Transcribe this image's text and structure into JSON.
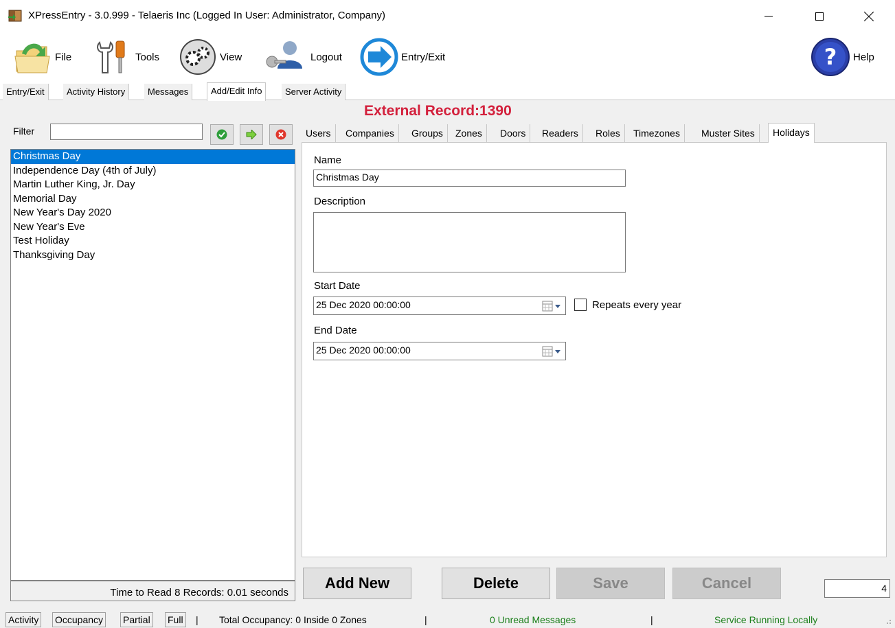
{
  "window": {
    "title": "XPressEntry - 3.0.999 - Telaeris Inc (Logged In User: Administrator, Company)",
    "controls": {
      "minimize": "—",
      "maximize": "☐",
      "close": "✕"
    }
  },
  "toolbar": {
    "items": [
      {
        "label": "File",
        "icon": "folder-icon"
      },
      {
        "label": "Tools",
        "icon": "tools-icon"
      },
      {
        "label": "View",
        "icon": "gears-icon"
      },
      {
        "label": "Logout",
        "icon": "user-key-icon"
      },
      {
        "label": "Entry/Exit",
        "icon": "entry-exit-arrow-icon"
      },
      {
        "label": "Help",
        "icon": "help-icon"
      }
    ]
  },
  "main_tabs": {
    "items": [
      "Entry/Exit",
      "Activity History",
      "Messages",
      "Add/Edit Info",
      "Server Activity"
    ],
    "active": "Add/Edit Info"
  },
  "external_record": "External Record:1390",
  "filter": {
    "label": "Filter",
    "value": ""
  },
  "holidays": {
    "items": [
      "Christmas Day",
      "Independence Day (4th of July)",
      "Martin Luther King, Jr. Day",
      "Memorial Day",
      "New Year's Day 2020",
      "New Year's Eve",
      "Test Holiday",
      "Thanksgiving Day"
    ],
    "selected": "Christmas Day",
    "footer": "Time to Read 8 Records: 0.01 seconds"
  },
  "sub_tabs": {
    "items": [
      "Users",
      "Companies",
      "Groups",
      "Zones",
      "Doors",
      "Readers",
      "Roles",
      "Timezones",
      "Muster Sites",
      "Holidays"
    ],
    "active": "Holidays"
  },
  "form": {
    "name_label": "Name",
    "name_value": "Christmas Day",
    "description_label": "Description",
    "description_value": "",
    "start_date_label": "Start Date",
    "start_date_value": "25 Dec 2020 00:00:00",
    "repeats_label": "Repeats every year",
    "repeats_checked": false,
    "end_date_label": "End Date",
    "end_date_value": "25 Dec 2020 00:00:00"
  },
  "actions": {
    "add_new": "Add New",
    "delete": "Delete",
    "save": "Save",
    "cancel": "Cancel",
    "counter_value": "4"
  },
  "statusbar": {
    "buttons": [
      "Activity",
      "Occupancy",
      "Partial",
      "Full"
    ],
    "separator": "|",
    "occupancy": "Total Occupancy: 0 Inside 0 Zones",
    "messages": "0 Unread Messages",
    "service": "Service Running Locally"
  },
  "colors": {
    "accent_red": "#d3203c",
    "selection_blue": "#0078d7",
    "status_green": "#1a7f1a"
  }
}
